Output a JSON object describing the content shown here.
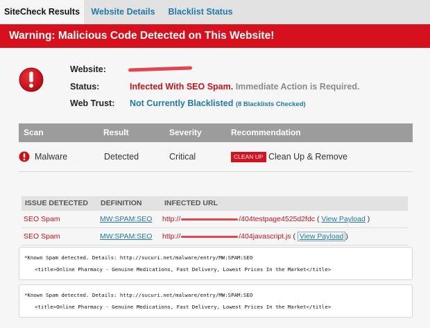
{
  "tabs": [
    {
      "label": "SiteCheck Results"
    },
    {
      "label": "Website Details"
    },
    {
      "label": "Blacklist Status"
    }
  ],
  "banner": {
    "text": "Warning: Malicious Code Detected on This Website!"
  },
  "info": {
    "website_label": "Website:",
    "status_label": "Status:",
    "status_value": "Infected With SEO Spam.",
    "status_note": "Immediate Action is Required.",
    "webtrust_label": "Web Trust:",
    "webtrust_value": "Not Currently Blacklisted",
    "webtrust_note": "(8 Blacklists Checked)"
  },
  "scan_table": {
    "headers": [
      "Scan",
      "Result",
      "Severity",
      "Recommendation"
    ],
    "row": {
      "scan": "Malware",
      "result": "Detected",
      "severity": "Critical",
      "button": "CLEAN UP",
      "recommendation": "Clean Up & Remove"
    }
  },
  "issues_table": {
    "headers": [
      "ISSUE DETECTED",
      "DEFINITION",
      "INFECTED URL"
    ],
    "rows": [
      {
        "issue": "SEO Spam",
        "definition": "MW:SPAM:SEO",
        "url_prefix": "http://",
        "url_suffix": "/404testpage4525d2fdc",
        "open": "( ",
        "link": "View Payload",
        "close": " )"
      },
      {
        "issue": "SEO Spam",
        "definition": "MW:SPAM:SEO",
        "url_prefix": "http://",
        "url_suffix": "/404javascript.js",
        "open": "( ",
        "link": "View Payload",
        "close": ")"
      }
    ]
  },
  "details": [
    {
      "line1": "*Known Spam detected. Details: http://sucuri.net/malware/entry/MW:SPAM:SEO",
      "line2": "<title>Online Pharmacy - Genuine Medications, Fast Delivery, Lowest Prices In the Market</title>"
    },
    {
      "line1": "*Known Spam detected. Details: http://sucuri.net/malware/entry/MW:SPAM:SEO",
      "line2": "<title>Online Pharmacy - Genuine Medications, Fast Delivery, Lowest Prices In the Market</title>"
    }
  ],
  "colors": {
    "brand_red": "#d6101c",
    "link_blue": "#1e79ad",
    "header_grey": "#9c9c9c"
  }
}
